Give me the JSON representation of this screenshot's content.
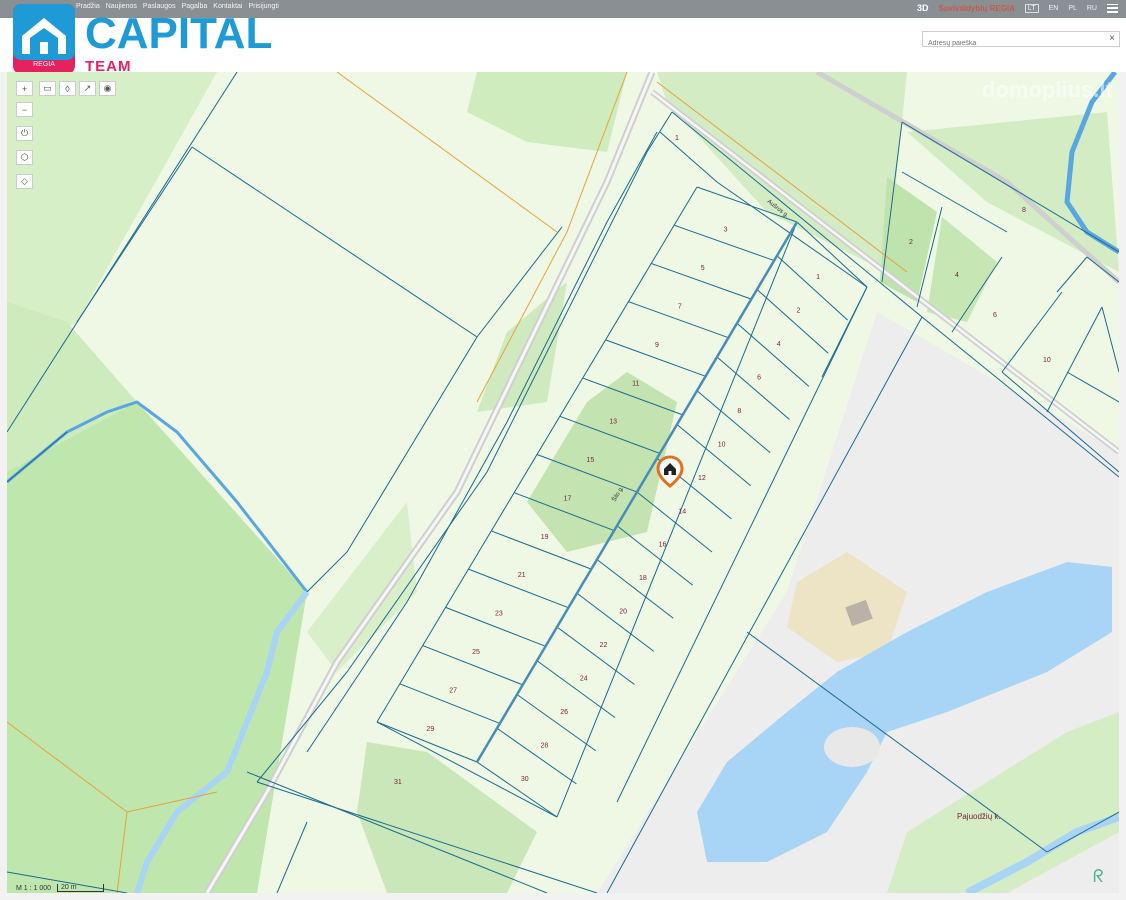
{
  "header": {
    "nav": [
      "Pradžia",
      "Naujienos",
      "Paslaugos",
      "Pagalba",
      "Kontaktai",
      "Prisijungti"
    ],
    "mode_3d": "3D",
    "brand": "Savivaldybių REGIA",
    "languages": [
      "LT",
      "EN",
      "PL",
      "RU"
    ],
    "active_language": "LT"
  },
  "search": {
    "placeholder": "Adresų paieška",
    "value": ""
  },
  "logo": {
    "name": "CAPITAL",
    "sub": "TEAM",
    "badge": "REGIA"
  },
  "watermark": "domoplius.lt",
  "map": {
    "roads": [
      "Aušros g.",
      "Šilo g."
    ],
    "village": "Pajuodžių k.",
    "parcels_left": [
      "3",
      "5",
      "7",
      "9",
      "11",
      "13",
      "15",
      "17",
      "19",
      "21",
      "23",
      "25",
      "27",
      "29"
    ],
    "parcels_right": [
      "1",
      "2",
      "4",
      "6",
      "8",
      "10",
      "12",
      "14",
      "16",
      "18",
      "20",
      "22",
      "24",
      "26",
      "28",
      "30"
    ],
    "parcel_top": "1",
    "parcel_big": "31",
    "parcels_ne": [
      "2",
      "4",
      "6",
      "8",
      "10"
    ],
    "marker": "home-marker",
    "scale_ratio": "M 1 : 1 000",
    "scale_bar": "20 m"
  },
  "colors": {
    "parcel_line": "#1b6b8f",
    "forest": "#bfe6ad",
    "water": "#a8d4f5",
    "accent": "#e5225f",
    "brand": "#1e9ad6",
    "marker": "#e07020"
  }
}
